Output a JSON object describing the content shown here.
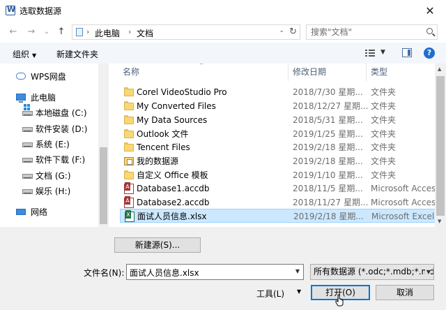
{
  "titlebar": {
    "title": "选取数据源",
    "close": "✕"
  },
  "nav": {
    "back": "←",
    "forward": "→",
    "history": "⌄",
    "up": "↑",
    "breadcrumb": [
      "此电脑",
      "文档"
    ],
    "crumb_sep": "›",
    "addr_dropdown": "⌄",
    "refresh": "↻",
    "search_placeholder": "搜索\"文档\""
  },
  "toolbar": {
    "organize": "组织",
    "organize_dropdown": "▼",
    "new_folder": "新建文件夹",
    "view_dropdown": "▼",
    "help": "?"
  },
  "sidebar": [
    {
      "label": "WPS网盘",
      "icon": "cloud-icon"
    },
    {
      "label": "此电脑",
      "icon": "computer-icon"
    },
    {
      "label": "本地磁盘 (C:)",
      "icon": "system-drive-icon"
    },
    {
      "label": "软件安装 (D:)",
      "icon": "drive-icon"
    },
    {
      "label": "系统 (E:)",
      "icon": "drive-icon"
    },
    {
      "label": "软件下载 (F:)",
      "icon": "drive-icon"
    },
    {
      "label": "文档 (G:)",
      "icon": "drive-icon"
    },
    {
      "label": "娱乐 (H:)",
      "icon": "drive-icon"
    },
    {
      "label": "网络",
      "icon": "network-icon"
    }
  ],
  "columns": {
    "name": "名称",
    "date": "修改日期",
    "type": "类型",
    "sort_indicator": "⌃"
  },
  "files": [
    {
      "name": "Corel VideoStudio Pro",
      "date": "2018/7/30 星期...",
      "type": "文件夹",
      "icon": "folder-icon"
    },
    {
      "name": "My Converted Files",
      "date": "2018/12/27 星期...",
      "type": "文件夹",
      "icon": "folder-icon"
    },
    {
      "name": "My Data Sources",
      "date": "2018/5/31 星期...",
      "type": "文件夹",
      "icon": "folder-icon"
    },
    {
      "name": "Outlook 文件",
      "date": "2019/1/25 星期...",
      "type": "文件夹",
      "icon": "folder-icon"
    },
    {
      "name": "Tencent Files",
      "date": "2019/2/18 星期...",
      "type": "文件夹",
      "icon": "folder-icon"
    },
    {
      "name": "我的数据源",
      "date": "2019/2/18 星期...",
      "type": "文件夹",
      "icon": "my-data-sources-icon"
    },
    {
      "name": "自定义 Office 模板",
      "date": "2019/1/10 星期...",
      "type": "文件夹",
      "icon": "folder-icon"
    },
    {
      "name": "Database1.accdb",
      "date": "2018/11/5 星期...",
      "type": "Microsoft Acces...",
      "icon": "access-file-icon"
    },
    {
      "name": "Database2.accdb",
      "date": "2018/11/27 星期...",
      "type": "Microsoft Acces...",
      "icon": "access-file-icon"
    },
    {
      "name": "面试人员信息.xlsx",
      "date": "2019/2/18 星期...",
      "type": "Microsoft Excel ...",
      "icon": "excel-file-icon",
      "selected": true
    }
  ],
  "footer": {
    "new_source": "新建源(S)...",
    "filename_label": "文件名(N):",
    "filename_value": "面试人员信息.xlsx",
    "filename_dropdown": "▼",
    "filetype": "所有数据源 (*.odc;*.mdb;*.mde",
    "filetype_dropdown": "▼",
    "tools": "工具(L)",
    "tools_dropdown": "▼",
    "open": "打开(O)",
    "cancel": "取消"
  },
  "scrollbar": {
    "up": "▲",
    "down": "▼"
  }
}
